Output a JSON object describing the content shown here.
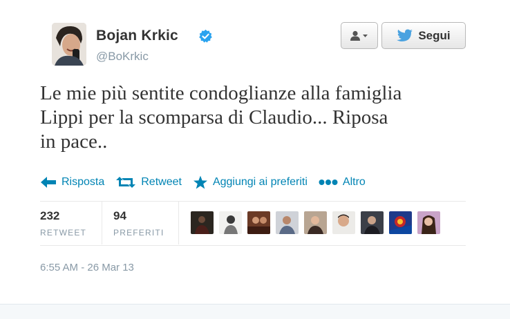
{
  "profile": {
    "name": "Bojan Krkic",
    "handle": "@BoKrkic",
    "verified": true,
    "avatar_icon": "profile-photo"
  },
  "buttons": {
    "user_menu_icon": "user-dropdown-icon",
    "follow_label": "Segui",
    "follow_icon": "twitter-bird-icon"
  },
  "tweet": {
    "lines": [
      "Le mie più sentite condoglianze alla famiglia",
      "Lippi per la scomparsa di Claudio... Riposa",
      "in pace.."
    ]
  },
  "actions": [
    {
      "label": "Risposta",
      "icon": "reply-icon"
    },
    {
      "label": "Retweet",
      "icon": "retweet-icon"
    },
    {
      "label": "Aggiungi ai preferiti",
      "icon": "star-icon"
    },
    {
      "label": "Altro",
      "icon": "more-dots-icon"
    }
  ],
  "stats": {
    "retweets": {
      "value": "232",
      "label": "RETWEET"
    },
    "favorites": {
      "value": "94",
      "label": "PREFERITI"
    }
  },
  "favoriters_count_shown": 9,
  "timestamp": "6:55 AM - 26 Mar 13",
  "colors": {
    "link": "#0084b4",
    "verified": "#2aa3ef",
    "muted": "#8899a6",
    "text": "#333333",
    "twitter_bird": "#4aa2e0"
  }
}
